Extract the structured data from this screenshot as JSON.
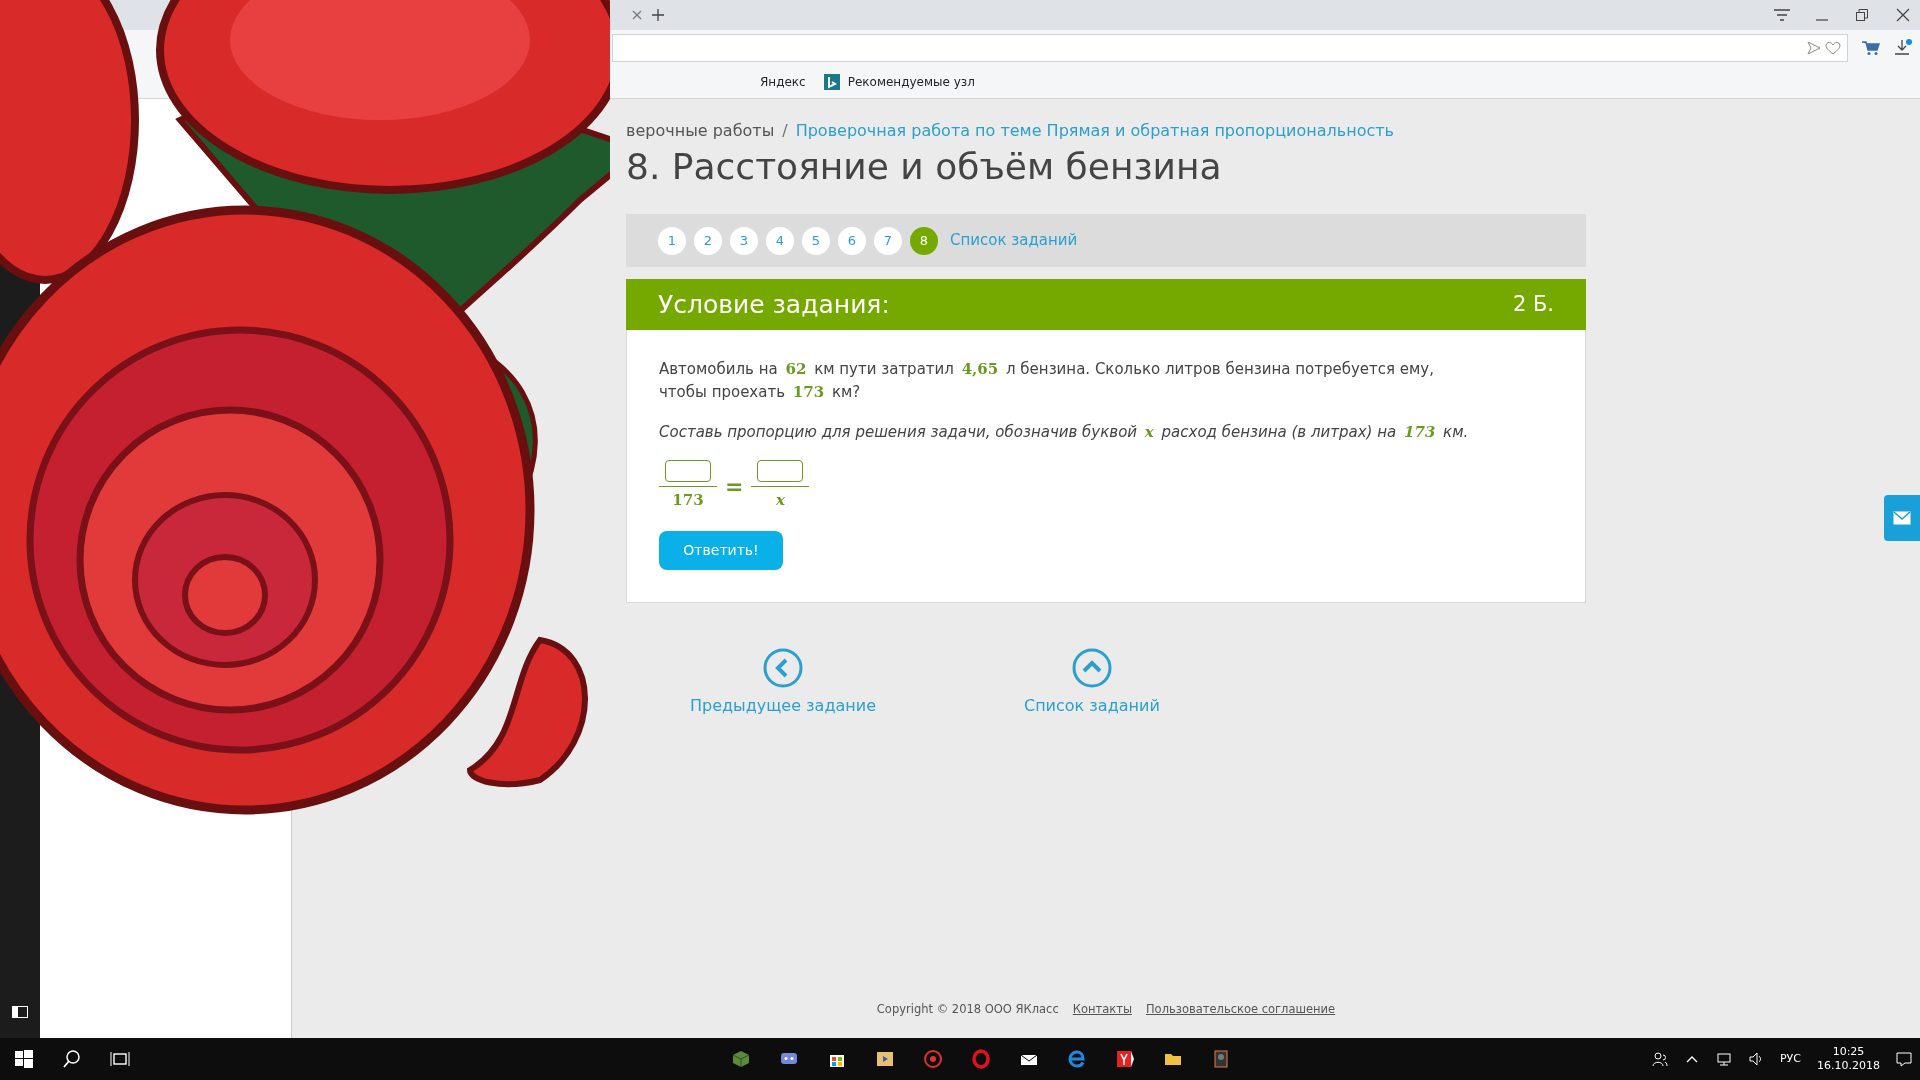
{
  "browser": {
    "bookmarks": [
      {
        "label": "Яндекс",
        "kind": "plain"
      },
      {
        "label": "Рекомендуемые узл",
        "kind": "bing"
      }
    ]
  },
  "breadcrumb": {
    "separator": "/",
    "items": [
      {
        "label": "верочные работы",
        "link": false
      },
      {
        "label": "Проверочная работа по теме Прямая и обратная пропорциональность",
        "link": true
      }
    ]
  },
  "title": "8. Расстояние и объём бензина",
  "task_nav": {
    "items": [
      {
        "label": "1",
        "selected": false
      },
      {
        "label": "2",
        "selected": false
      },
      {
        "label": "3",
        "selected": false
      },
      {
        "label": "4",
        "selected": false
      },
      {
        "label": "5",
        "selected": false
      },
      {
        "label": "6",
        "selected": false
      },
      {
        "label": "7",
        "selected": false
      },
      {
        "label": "8",
        "selected": true
      }
    ],
    "list_link": "Список заданий"
  },
  "task": {
    "header": "Условие задания:",
    "points": "2 Б.",
    "problem": [
      {
        "kind": "text",
        "text": "Автомобиль на "
      },
      {
        "kind": "math",
        "text": "62"
      },
      {
        "kind": "text",
        "text": " км пути затратил "
      },
      {
        "kind": "math",
        "text": "4,65"
      },
      {
        "kind": "text",
        "text": " л бензина. Сколько литров бензина потребуется ему, чтобы проехать "
      },
      {
        "kind": "math",
        "text": "173"
      },
      {
        "kind": "text",
        "text": " км?"
      }
    ],
    "instruction": [
      {
        "kind": "text",
        "text": "Составь пропорцию для решения задачи, обозначив буквой "
      },
      {
        "kind": "math",
        "text": "x"
      },
      {
        "kind": "text",
        "text": " расход бензина (в литрах) на "
      },
      {
        "kind": "math",
        "text": "173"
      },
      {
        "kind": "text",
        "text": " км."
      }
    ],
    "fraction": {
      "left_denominator": "173",
      "equals": "=",
      "right_denominator": "x"
    },
    "submit": "Ответить!"
  },
  "bottom_nav": [
    {
      "kind": "prev",
      "label": "Предыдущее задание"
    },
    {
      "kind": "up",
      "label": "Список заданий"
    }
  ],
  "footer": {
    "copyright": "Copyright © 2018 ООО ЯКласс",
    "links": [
      "Контакты",
      "Пользовательское соглашение"
    ]
  },
  "taskbar": {
    "language": "РУС",
    "time": "10:25",
    "date": "16.10.2018"
  }
}
